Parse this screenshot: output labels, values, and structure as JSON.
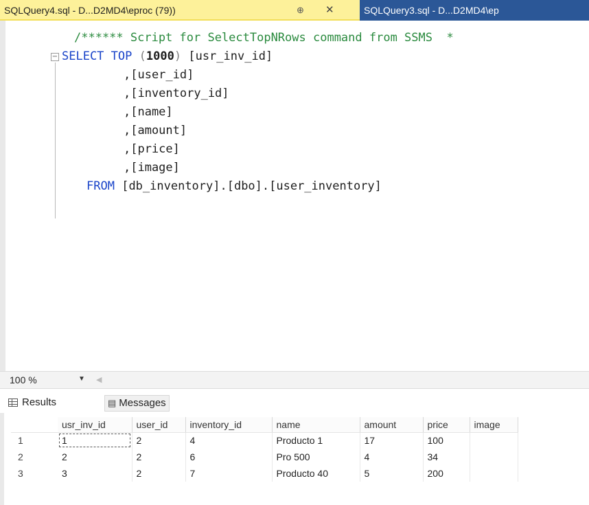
{
  "tabs": {
    "active_title": "SQLQuery4.sql - D...D2MD4\\eproc (79))",
    "pin_glyph": "⊕",
    "close_glyph": "✕",
    "inactive_title": "SQLQuery3.sql - D...D2MD4\\ep"
  },
  "editor": {
    "comment": "/****** Script for SelectTopNRows command from SSMS  *",
    "line_select_kw1": "SELECT",
    "line_select_kw2": "TOP",
    "line_select_paren_open": "(",
    "line_select_num": "1000",
    "line_select_paren_close": ")",
    "line_select_col": "[usr_inv_id]",
    "columns": [
      ",[user_id]",
      ",[inventory_id]",
      ",[name]",
      ",[amount]",
      ",[price]",
      ",[image]"
    ],
    "from_kw": "FROM",
    "from_table": "[db_inventory].[dbo].[user_inventory]",
    "fold_glyph": "−"
  },
  "zoom": {
    "label": "100 %"
  },
  "result_tabs": {
    "results": "Results",
    "messages": "Messages"
  },
  "grid": {
    "headers": [
      "usr_inv_id",
      "user_id",
      "inventory_id",
      "name",
      "amount",
      "price",
      "image"
    ],
    "rows": [
      {
        "num": "1",
        "cells": [
          "1",
          "2",
          "4",
          "Producto 1",
          "17",
          "100",
          ""
        ]
      },
      {
        "num": "2",
        "cells": [
          "2",
          "2",
          "6",
          "Pro 500",
          "4",
          "34",
          ""
        ]
      },
      {
        "num": "3",
        "cells": [
          "3",
          "2",
          "7",
          "Producto 40",
          "5",
          "200",
          ""
        ]
      }
    ]
  },
  "colors": {
    "active_tab_bg": "#fdf19a",
    "inactive_tab_bg": "#2b5797",
    "keyword": "#1a44c9",
    "comment": "#2a8a3e"
  }
}
